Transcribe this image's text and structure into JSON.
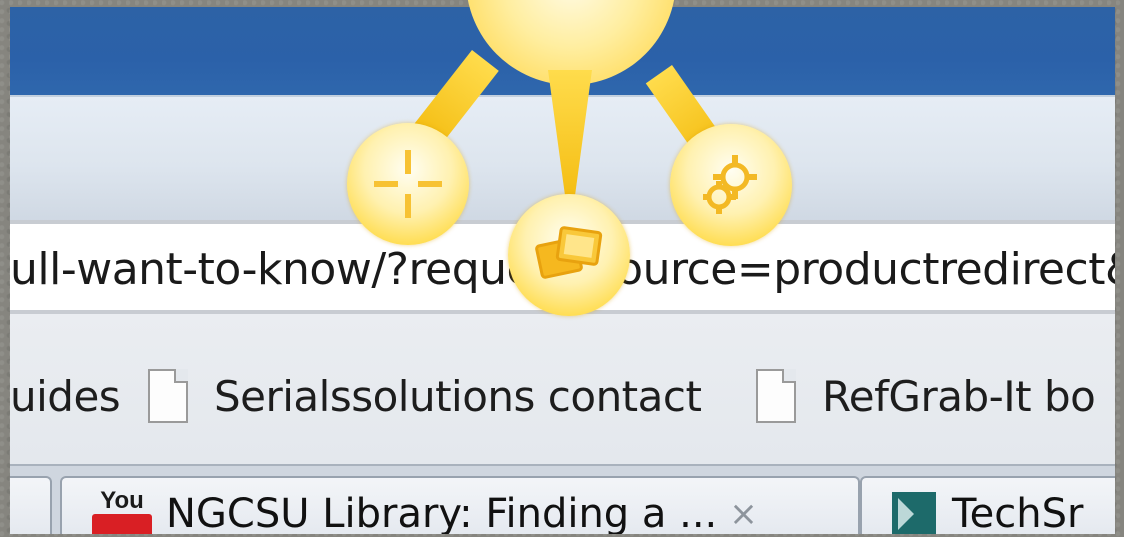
{
  "address_bar": {
    "url_text": "ull-want-to-know/?request_source=productredirect&"
  },
  "bookmarks_bar": {
    "items": [
      {
        "label": "uides"
      },
      {
        "label": "Serialssolutions contact"
      },
      {
        "label": "RefGrab-It bo"
      }
    ]
  },
  "tabs": [
    {
      "label": "NGCSU Library: Finding a ...",
      "close": "×",
      "icon": "youtube-icon",
      "icon_text": "You"
    },
    {
      "label": "TechSr",
      "icon": "techsmith-icon"
    }
  ],
  "sun_menu": {
    "buttons": [
      {
        "name": "crosshair-icon"
      },
      {
        "name": "images-icon"
      },
      {
        "name": "gear-icon"
      }
    ]
  },
  "colors": {
    "titlebar": "#2b61a9",
    "sun": "#ffd93e"
  }
}
